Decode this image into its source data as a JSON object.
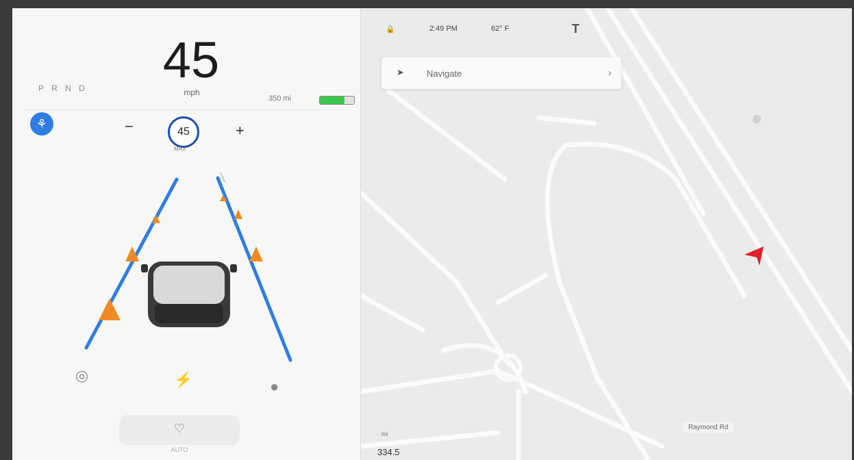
{
  "driving": {
    "speed": "45",
    "speed_unit": "mph",
    "gear": "P R N D",
    "range": "350 mi",
    "battery_level": 0.72,
    "set_speed": "45",
    "set_speed_sublabel": "MAX",
    "minus_label": "−",
    "plus_label": "+",
    "autopilot_icon": "steering-wheel-icon",
    "bottom_icons": [
      "camera-icon",
      "lightning-icon",
      "microphone-icon"
    ],
    "wiper_label": "AUTO",
    "lane_color": "#2f7de1",
    "cone_color": "#f08a24"
  },
  "status_bar": {
    "lock_icon": "lock-icon",
    "time": "2:49 PM",
    "temperature": "62° F",
    "logo": "T"
  },
  "map": {
    "navigate_icon": "nav-arrow-icon",
    "navigate_placeholder": "Navigate",
    "navigate_chevron": "›",
    "road_label": "Raymond Rd",
    "odometer_label": "mi",
    "odometer_value": "334.5",
    "position_icon": "location-pointer-icon",
    "position_color": "#e0202b"
  }
}
